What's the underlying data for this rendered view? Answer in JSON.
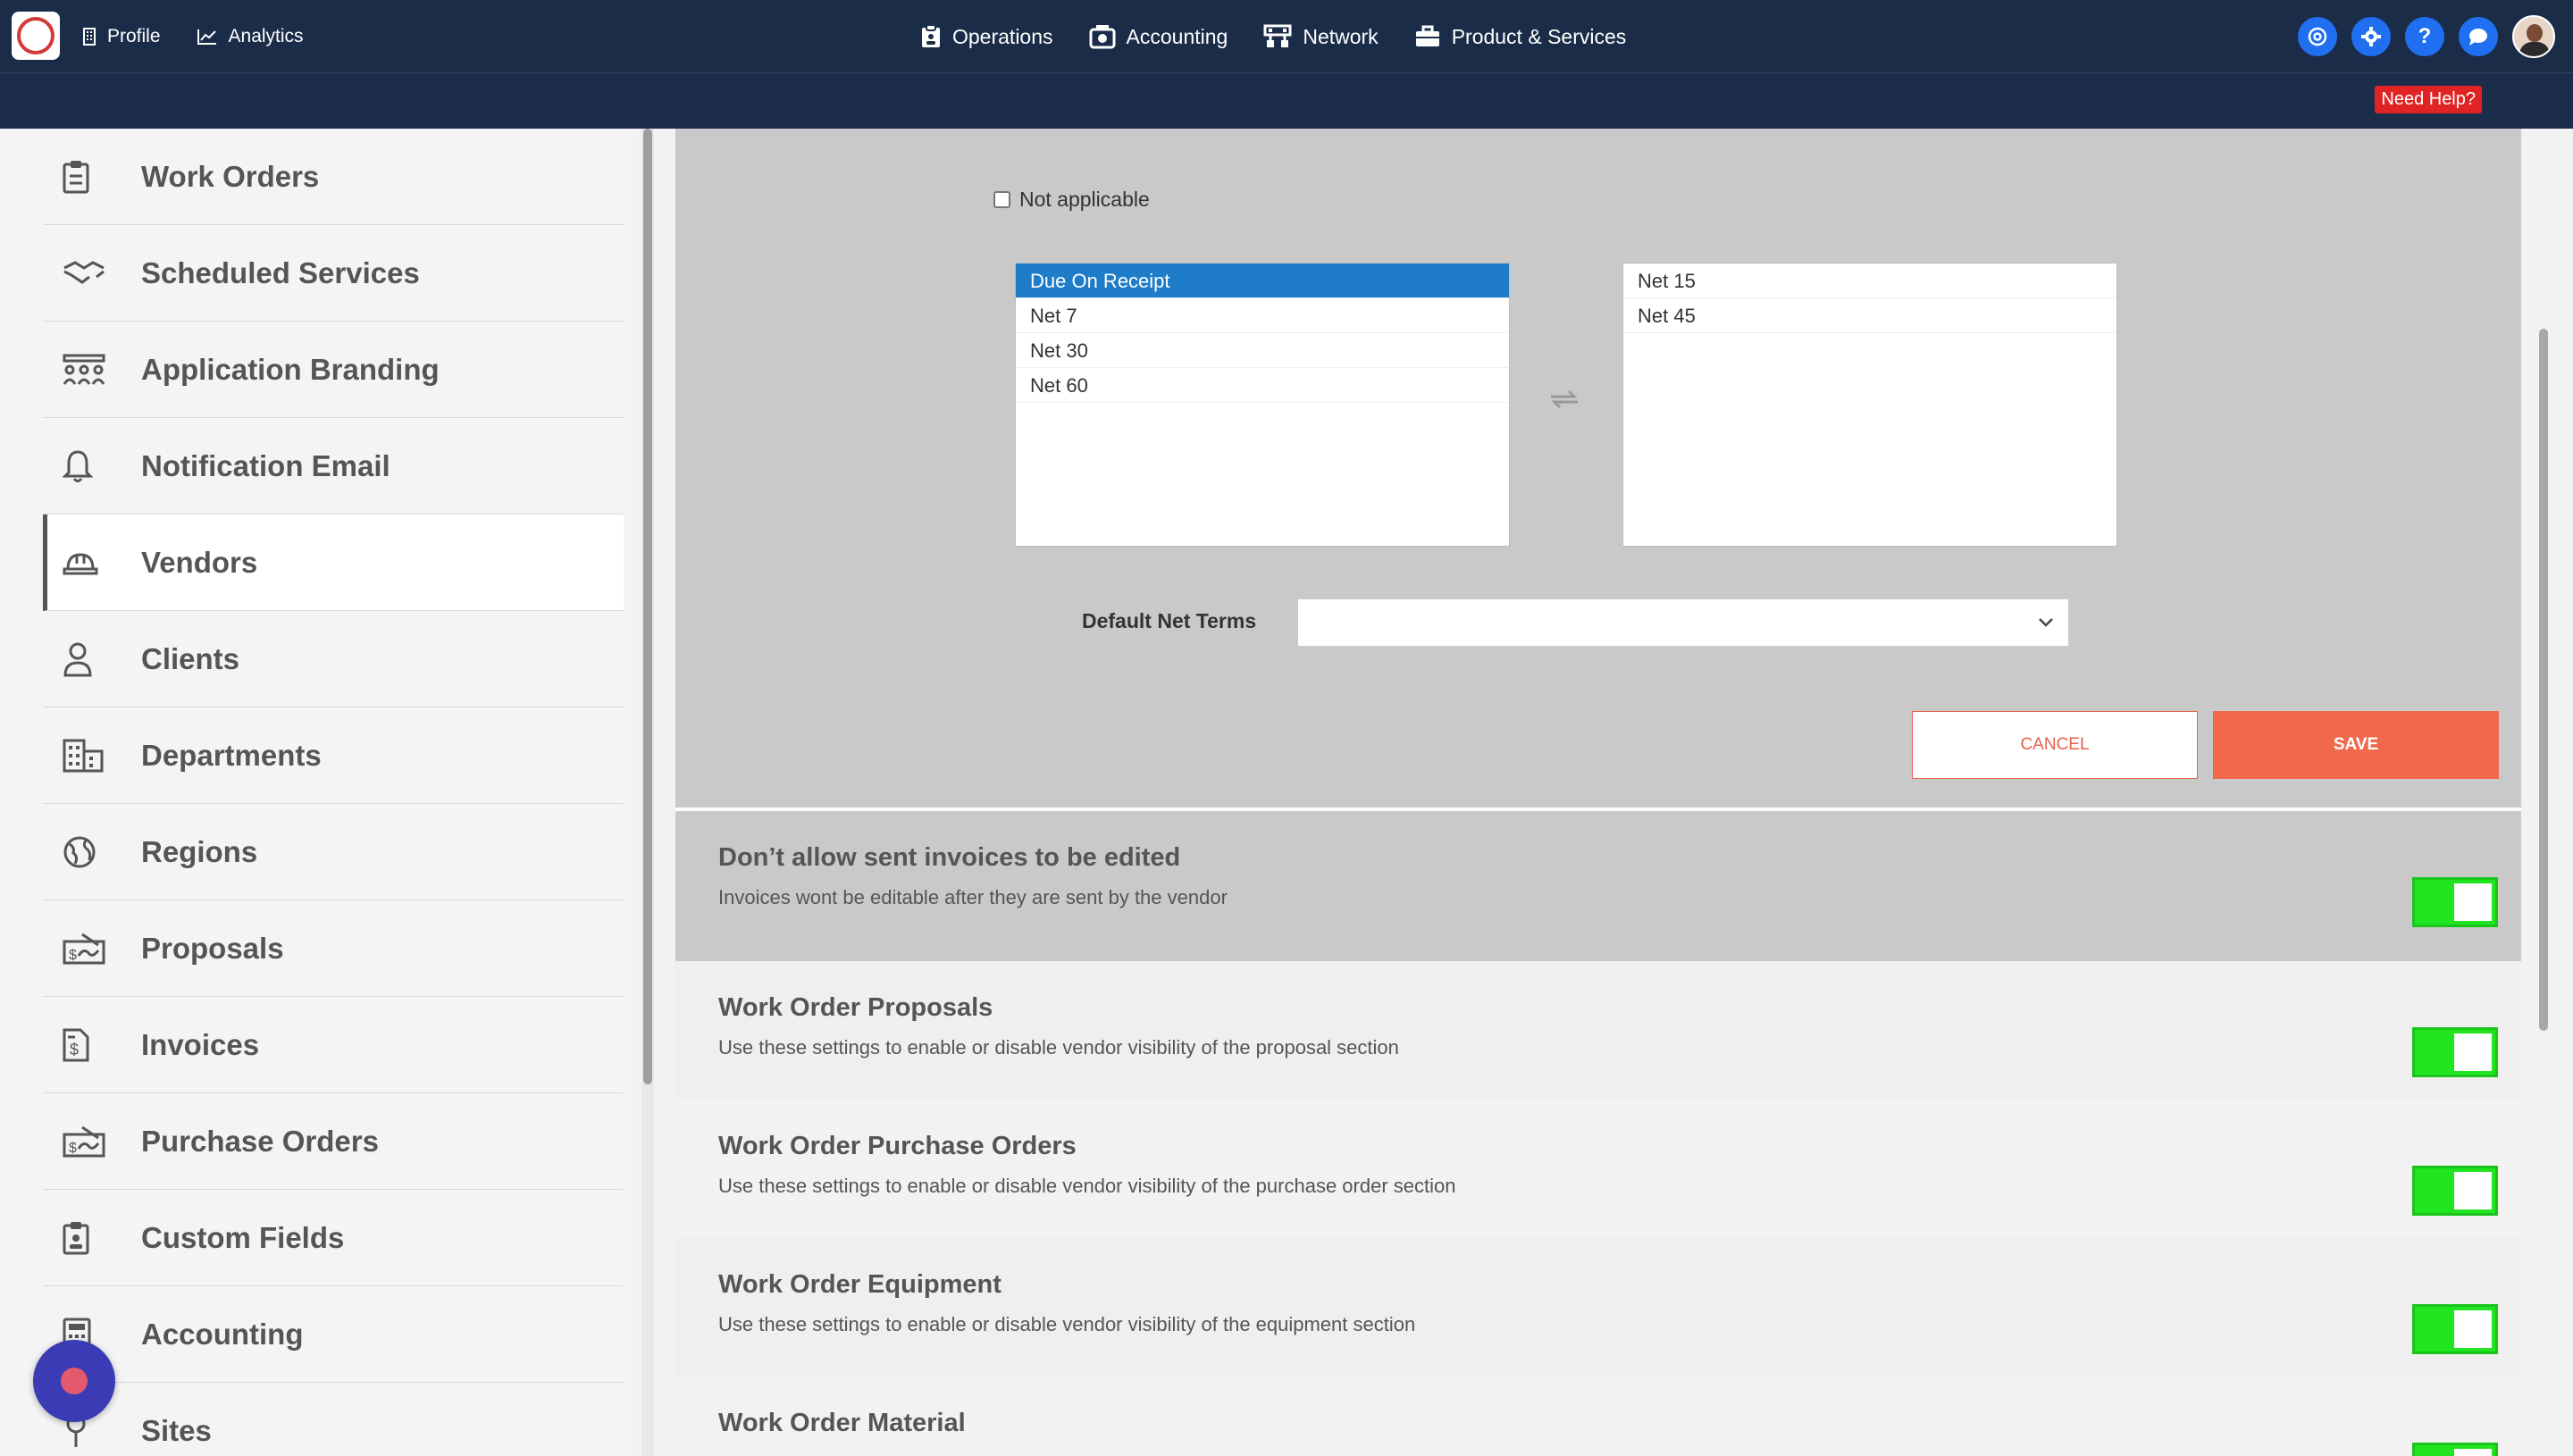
{
  "topnav": {
    "profile": "Profile",
    "analytics": "Analytics",
    "operations": "Operations",
    "accounting": "Accounting",
    "network": "Network",
    "products": "Product & Services",
    "help_q": "?"
  },
  "subbar": {
    "need_help": "Need Help?"
  },
  "sidebar": {
    "items": [
      {
        "label": "Work Orders"
      },
      {
        "label": "Scheduled Services"
      },
      {
        "label": "Application Branding"
      },
      {
        "label": "Notification Email"
      },
      {
        "label": "Vendors"
      },
      {
        "label": "Clients"
      },
      {
        "label": "Departments"
      },
      {
        "label": "Regions"
      },
      {
        "label": "Proposals"
      },
      {
        "label": "Invoices"
      },
      {
        "label": "Purchase Orders"
      },
      {
        "label": "Custom Fields"
      },
      {
        "label": "Accounting"
      },
      {
        "label": "Sites"
      }
    ],
    "active": "Vendors"
  },
  "terms": {
    "not_applicable": "Not applicable",
    "available": [
      "Due On Receipt",
      "Net 7",
      "Net 30",
      "Net 60"
    ],
    "selected_available": "Due On Receipt",
    "chosen": [
      "Net 15",
      "Net 45"
    ],
    "default_label": "Default Net Terms",
    "default_value": "",
    "cancel": "CANCEL",
    "save": "SAVE"
  },
  "settings": [
    {
      "title": "Don’t allow sent invoices to be edited",
      "desc": "Invoices wont be editable after they are sent by the vendor",
      "enabled": true
    },
    {
      "title": "Work Order Proposals",
      "desc": "Use these settings to enable or disable vendor visibility of the proposal section",
      "enabled": true
    },
    {
      "title": "Work Order Purchase Orders",
      "desc": "Use these settings to enable or disable vendor visibility of the purchase order section",
      "enabled": true
    },
    {
      "title": "Work Order Equipment",
      "desc": "Use these settings to enable or disable vendor visibility of the equipment section",
      "enabled": true
    },
    {
      "title": "Work Order Material",
      "desc": "",
      "enabled": true
    }
  ],
  "colors": {
    "topbar": "#1a2c47",
    "accent_blue": "#1f6ff0",
    "save": "#f0694c",
    "toggle_on": "#22e522",
    "list_selected": "#1e7cc8"
  }
}
